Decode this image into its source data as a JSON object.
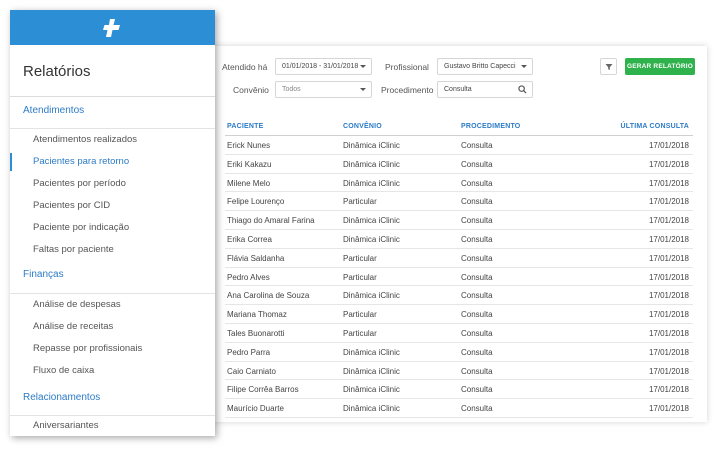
{
  "sidebar": {
    "title": "Relatórios",
    "sections": [
      {
        "heading": "Atendimentos",
        "items": [
          {
            "label": "Atendimentos realizados",
            "active": false
          },
          {
            "label": "Pacientes para retorno",
            "active": true
          },
          {
            "label": "Pacientes por período",
            "active": false
          },
          {
            "label": "Pacientes por CID",
            "active": false
          },
          {
            "label": "Paciente por indicação",
            "active": false
          },
          {
            "label": "Faltas por paciente",
            "active": false
          }
        ]
      },
      {
        "heading": "Finanças",
        "items": [
          {
            "label": "Análise de despesas",
            "active": false
          },
          {
            "label": "Análise de receitas",
            "active": false
          },
          {
            "label": "Repasse por profissionais",
            "active": false
          },
          {
            "label": "Fluxo de caixa",
            "active": false
          }
        ]
      },
      {
        "heading": "Relacionamentos",
        "items": [
          {
            "label": "Aniversariantes",
            "active": false
          }
        ]
      }
    ]
  },
  "filters": {
    "attended_label": "Atendido há",
    "attended_value": "01/01/2018 - 31/01/2018",
    "professional_label": "Profissional",
    "professional_value": "Gustavo Britto Capecci",
    "insurance_label": "Convênio",
    "insurance_value": "Todos",
    "procedure_label": "Procedimento",
    "procedure_value": "Consulta",
    "generate_label": "GERAR RELATÓRIO"
  },
  "table": {
    "columns": [
      "PACIENTE",
      "CONVÊNIO",
      "PROCEDIMENTO",
      "ÚLTIMA CONSULTA"
    ],
    "rows": [
      [
        "Erick Nunes",
        "Dinâmica iClinic",
        "Consulta",
        "17/01/2018"
      ],
      [
        "Eriki Kakazu",
        "Dinâmica iClinic",
        "Consulta",
        "17/01/2018"
      ],
      [
        "Milene Melo",
        "Dinâmica iClinic",
        "Consulta",
        "17/01/2018"
      ],
      [
        "Felipe Lourenço",
        "Particular",
        "Consulta",
        "17/01/2018"
      ],
      [
        "Thiago do Amaral Farina",
        "Dinâmica iClinic",
        "Consulta",
        "17/01/2018"
      ],
      [
        "Erika Correa",
        "Dinâmica iClinic",
        "Consulta",
        "17/01/2018"
      ],
      [
        "Flávia Saldanha",
        "Particular",
        "Consulta",
        "17/01/2018"
      ],
      [
        "Pedro Alves",
        "Particular",
        "Consulta",
        "17/01/2018"
      ],
      [
        "Ana Carolina de Souza",
        "Dinâmica iClinic",
        "Consulta",
        "17/01/2018"
      ],
      [
        "Mariana Thomaz",
        "Particular",
        "Consulta",
        "17/01/2018"
      ],
      [
        "Tales Buonarotti",
        "Particular",
        "Consulta",
        "17/01/2018"
      ],
      [
        "Pedro Parra",
        "Dinâmica iClinic",
        "Consulta",
        "17/01/2018"
      ],
      [
        "Caio Carniato",
        "Dinâmica iClinic",
        "Consulta",
        "17/01/2018"
      ],
      [
        "Filipe Corrêa Barros",
        "Dinâmica iClinic",
        "Consulta",
        "17/01/2018"
      ],
      [
        "Maurício Duarte",
        "Dinâmica iClinic",
        "Consulta",
        "17/01/2018"
      ]
    ]
  },
  "icons": {
    "logo": "plus-logo-icon",
    "filter": "funnel-icon",
    "search": "search-icon",
    "dropdown": "chevron-down-icon"
  },
  "colors": {
    "brand_blue": "#2c8fd6",
    "link_blue": "#2c7bc7",
    "action_green": "#2fb24c"
  }
}
